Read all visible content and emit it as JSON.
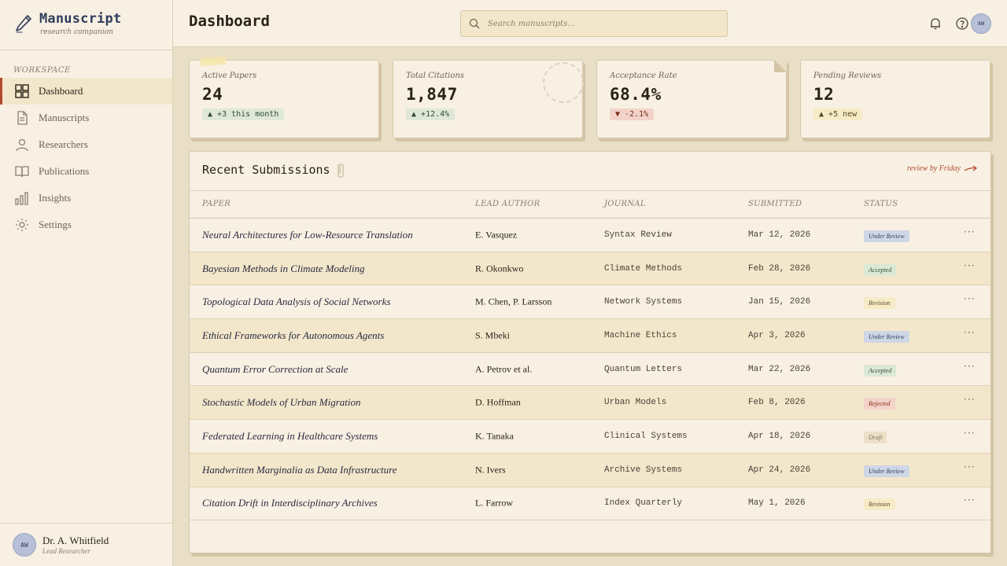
{
  "brand": {
    "name": "Manuscript",
    "tagline": "research companion"
  },
  "nav": {
    "section": "WORKSPACE",
    "items": [
      {
        "label": "Dashboard",
        "icon": "grid-icon"
      },
      {
        "label": "Manuscripts",
        "icon": "document-icon"
      },
      {
        "label": "Researchers",
        "icon": "person-icon"
      },
      {
        "label": "Publications",
        "icon": "book-icon"
      },
      {
        "label": "Insights",
        "icon": "bar-chart-icon"
      },
      {
        "label": "Settings",
        "icon": "gear-icon"
      }
    ]
  },
  "user": {
    "initials": "AW",
    "name": "Dr. A. Whitfield",
    "role": "Lead Researcher"
  },
  "header": {
    "title": "Dashboard",
    "search_placeholder": "Search manuscripts...",
    "avatar_initials": "AW"
  },
  "stats": [
    {
      "label": "Active Papers",
      "value": "24",
      "change": "+3 this month",
      "trend": "up"
    },
    {
      "label": "Total Citations",
      "value": "1,847",
      "change": "+12.4%",
      "trend": "up"
    },
    {
      "label": "Acceptance Rate",
      "value": "68.4%",
      "change": "-2.1%",
      "trend": "down"
    },
    {
      "label": "Pending Reviews",
      "value": "12",
      "change": "+5 new",
      "trend": "warn"
    }
  ],
  "submissions": {
    "title": "Recent Submissions",
    "note": "review by Friday",
    "columns": [
      "PAPER",
      "LEAD AUTHOR",
      "JOURNAL",
      "SUBMITTED",
      "STATUS"
    ],
    "rows": [
      {
        "paper": "Neural Architectures for Low-Resource Translation",
        "author": "E. Vasquez",
        "journal": "Syntax Review",
        "submitted": "Mar 12, 2026",
        "status": "Under Review"
      },
      {
        "paper": "Bayesian Methods in Climate Modeling",
        "author": "R. Okonkwo",
        "journal": "Climate Methods",
        "submitted": "Feb 28, 2026",
        "status": "Accepted"
      },
      {
        "paper": "Topological Data Analysis of Social Networks",
        "author": "M. Chen, P. Larsson",
        "journal": "Network Systems",
        "submitted": "Jan 15, 2026",
        "status": "Revision"
      },
      {
        "paper": "Ethical Frameworks for Autonomous Agents",
        "author": "S. Mbeki",
        "journal": "Machine Ethics",
        "submitted": "Apr 3, 2026",
        "status": "Under Review"
      },
      {
        "paper": "Quantum Error Correction at Scale",
        "author": "A. Petrov et al.",
        "journal": "Quantum Letters",
        "submitted": "Mar 22, 2026",
        "status": "Accepted"
      },
      {
        "paper": "Stochastic Models of Urban Migration",
        "author": "D. Hoffman",
        "journal": "Urban Models",
        "submitted": "Feb 8, 2026",
        "status": "Rejected"
      },
      {
        "paper": "Federated Learning in Healthcare Systems",
        "author": "K. Tanaka",
        "journal": "Clinical Systems",
        "submitted": "Apr 18, 2026",
        "status": "Draft"
      },
      {
        "paper": "Handwritten Marginalia as Data Infrastructure",
        "author": "N. Ivers",
        "journal": "Archive Systems",
        "submitted": "Apr 24, 2026",
        "status": "Under Review"
      },
      {
        "paper": "Citation Drift in Interdisciplinary Archives",
        "author": "L. Farrow",
        "journal": "Index Quarterly",
        "submitted": "May 1, 2026",
        "status": "Revision"
      }
    ],
    "menu_glyph": "···"
  },
  "colors": {
    "accent": "#b04a2f",
    "ink_blue": "#2f3e5c",
    "paper": "#f8f0e3",
    "background": "#e9dfc7"
  }
}
